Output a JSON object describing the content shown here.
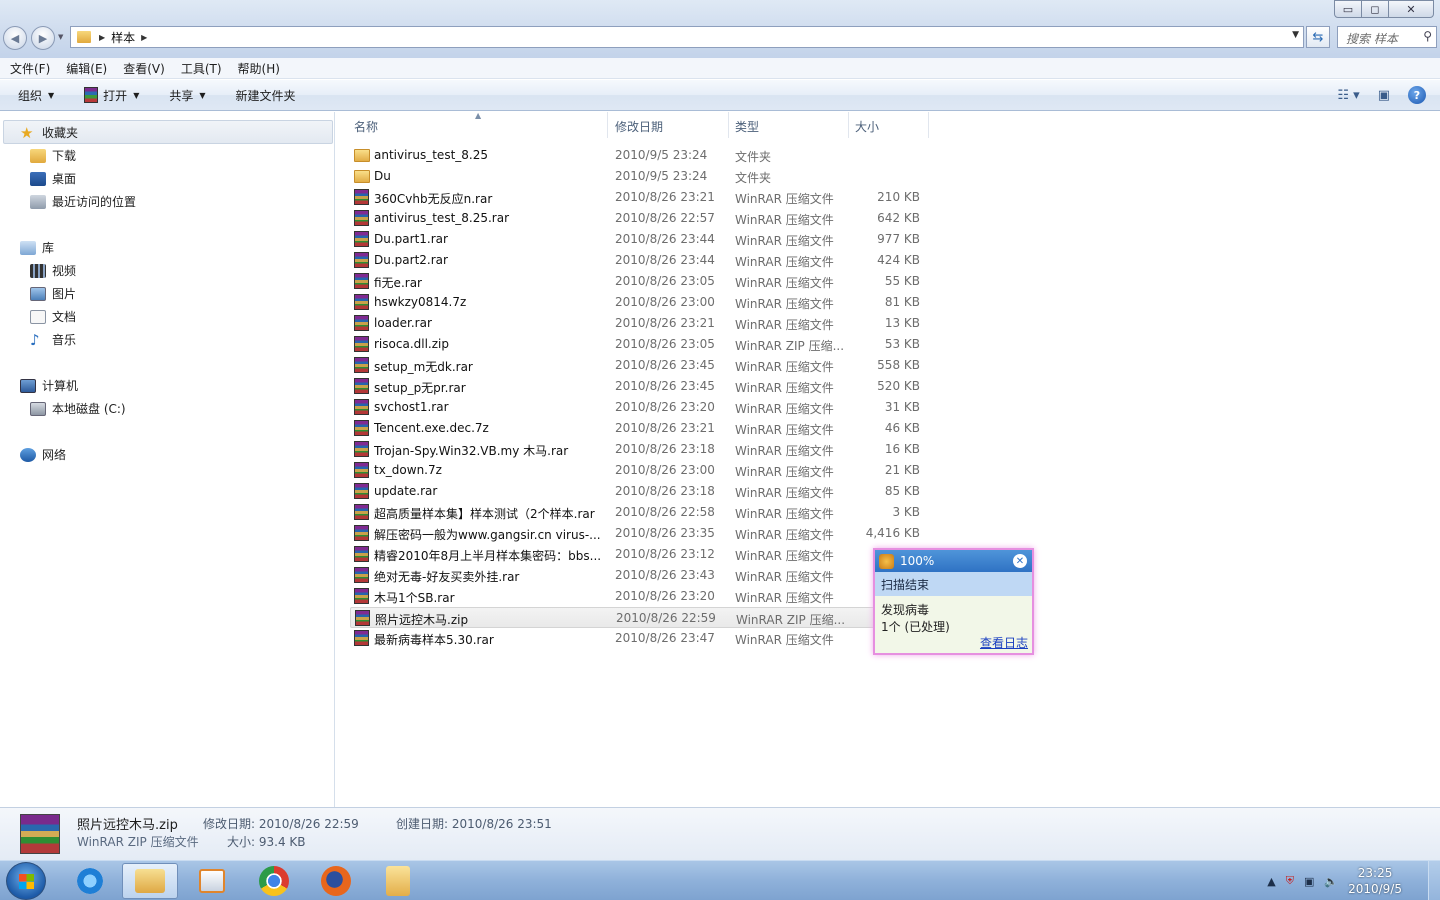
{
  "window": {
    "minimize_glyph": "▭",
    "maximize_glyph": "◻",
    "close_glyph": "✕"
  },
  "address": {
    "crumbs": [
      "样本"
    ],
    "search_placeholder": "搜索 样本"
  },
  "menu": [
    "文件(F)",
    "编辑(E)",
    "查看(V)",
    "工具(T)",
    "帮助(H)"
  ],
  "commands": {
    "organize": "组织",
    "open": "打开",
    "share": "共享",
    "new_folder": "新建文件夹"
  },
  "nav": {
    "favorites": "收藏夹",
    "downloads": "下载",
    "desktop": "桌面",
    "recent": "最近访问的位置",
    "libraries": "库",
    "videos": "视频",
    "pictures": "图片",
    "documents": "文档",
    "music": "音乐",
    "computer": "计算机",
    "local_disk": "本地磁盘 (C:)",
    "network": "网络"
  },
  "columns": {
    "name": "名称",
    "date": "修改日期",
    "type": "类型",
    "size": "大小"
  },
  "files": [
    {
      "icon": "folder",
      "name": "antivirus_test_8.25",
      "date": "2010/9/5 23:24",
      "type": "文件夹",
      "size": ""
    },
    {
      "icon": "folder",
      "name": "Du",
      "date": "2010/9/5 23:24",
      "type": "文件夹",
      "size": ""
    },
    {
      "icon": "rar",
      "name": "360Cvhb无反应n.rar",
      "date": "2010/8/26 23:21",
      "type": "WinRAR 压缩文件",
      "size": "210 KB"
    },
    {
      "icon": "rar",
      "name": "antivirus_test_8.25.rar",
      "date": "2010/8/26 22:57",
      "type": "WinRAR 压缩文件",
      "size": "642 KB"
    },
    {
      "icon": "rar",
      "name": "Du.part1.rar",
      "date": "2010/8/26 23:44",
      "type": "WinRAR 压缩文件",
      "size": "977 KB"
    },
    {
      "icon": "rar",
      "name": "Du.part2.rar",
      "date": "2010/8/26 23:44",
      "type": "WinRAR 压缩文件",
      "size": "424 KB"
    },
    {
      "icon": "rar",
      "name": "fi无e.rar",
      "date": "2010/8/26 23:05",
      "type": "WinRAR 压缩文件",
      "size": "55 KB"
    },
    {
      "icon": "rar",
      "name": "hswkzy0814.7z",
      "date": "2010/8/26 23:00",
      "type": "WinRAR 压缩文件",
      "size": "81 KB"
    },
    {
      "icon": "rar",
      "name": "loader.rar",
      "date": "2010/8/26 23:21",
      "type": "WinRAR 压缩文件",
      "size": "13 KB"
    },
    {
      "icon": "rar",
      "name": "risoca.dll.zip",
      "date": "2010/8/26 23:05",
      "type": "WinRAR ZIP 压缩...",
      "size": "53 KB"
    },
    {
      "icon": "rar",
      "name": "setup_m无dk.rar",
      "date": "2010/8/26 23:45",
      "type": "WinRAR 压缩文件",
      "size": "558 KB"
    },
    {
      "icon": "rar",
      "name": "setup_p无pr.rar",
      "date": "2010/8/26 23:45",
      "type": "WinRAR 压缩文件",
      "size": "520 KB"
    },
    {
      "icon": "rar",
      "name": "svchost1.rar",
      "date": "2010/8/26 23:20",
      "type": "WinRAR 压缩文件",
      "size": "31 KB"
    },
    {
      "icon": "rar",
      "name": "Tencent.exe.dec.7z",
      "date": "2010/8/26 23:21",
      "type": "WinRAR 压缩文件",
      "size": "46 KB"
    },
    {
      "icon": "rar",
      "name": "Trojan-Spy.Win32.VB.my 木马.rar",
      "date": "2010/8/26 23:18",
      "type": "WinRAR 压缩文件",
      "size": "16 KB"
    },
    {
      "icon": "rar",
      "name": "tx_down.7z",
      "date": "2010/8/26 23:00",
      "type": "WinRAR 压缩文件",
      "size": "21 KB"
    },
    {
      "icon": "rar",
      "name": "update.rar",
      "date": "2010/8/26 23:18",
      "type": "WinRAR 压缩文件",
      "size": "85 KB"
    },
    {
      "icon": "rar",
      "name": "超高质量样本集】样本测试（2个样本.rar",
      "date": "2010/8/26 22:58",
      "type": "WinRAR 压缩文件",
      "size": "3 KB"
    },
    {
      "icon": "rar",
      "name": "解压密码一般为www.gangsir.cn  virus-...",
      "date": "2010/8/26 23:35",
      "type": "WinRAR 压缩文件",
      "size": "4,416 KB"
    },
    {
      "icon": "rar",
      "name": "精睿2010年8月上半月样本集密码：bbs....",
      "date": "2010/8/26 23:12",
      "type": "WinRAR 压缩文件",
      "size": "99"
    },
    {
      "icon": "rar",
      "name": "绝对无毒-好友买卖外挂.rar",
      "date": "2010/8/26 23:43",
      "type": "WinRAR 压缩文件",
      "size": ""
    },
    {
      "icon": "rar",
      "name": "木马1个SB.rar",
      "date": "2010/8/26 23:20",
      "type": "WinRAR 压缩文件",
      "size": ""
    },
    {
      "icon": "rar",
      "name": "照片远控木马.zip",
      "date": "2010/8/26 22:59",
      "type": "WinRAR ZIP 压缩...",
      "size": "",
      "selected": true
    },
    {
      "icon": "rar",
      "name": "最新病毒样本5.30.rar",
      "date": "2010/8/26 23:47",
      "type": "WinRAR 压缩文件",
      "size": ""
    }
  ],
  "popup": {
    "percent": "100%",
    "status": "扫描结束",
    "line1": "发现病毒",
    "line2": "1个 (已处理)",
    "log_link": "查看日志"
  },
  "details": {
    "filename": "照片远控木马.zip",
    "filetype": "WinRAR ZIP 压缩文件",
    "modified_label": "修改日期: 2010/8/26 22:59",
    "size_label": "大小: 93.4 KB",
    "created_label": "创建日期: 2010/8/26 23:51"
  },
  "taskbar": {
    "time": "23:25",
    "date": "2010/9/5"
  }
}
